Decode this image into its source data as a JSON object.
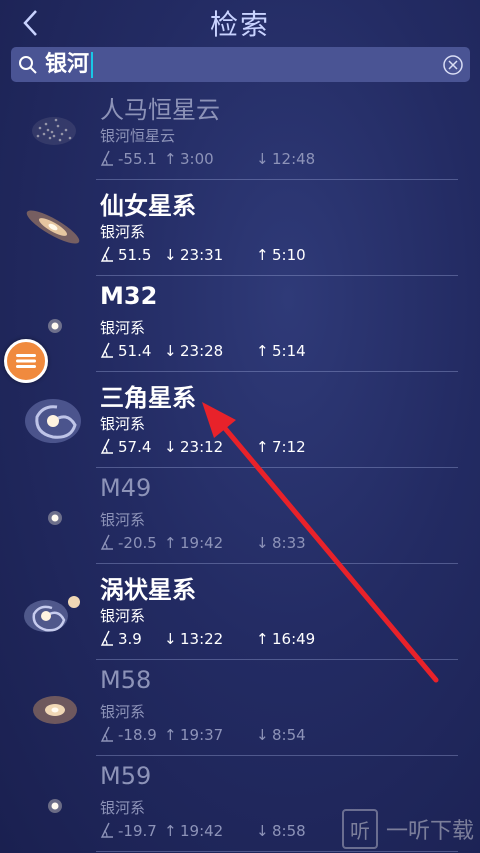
{
  "header": {
    "title": "检索",
    "back_icon": "chevron-left-icon"
  },
  "search": {
    "value": "银河",
    "search_icon": "magnifier-icon",
    "clear_icon": "clear-circle-icon"
  },
  "fab": {
    "icon": "menu-icon",
    "color": "#f08a3e"
  },
  "results": [
    {
      "name": "人马恒星云",
      "type": "银河恒星云",
      "alt": "-55.1",
      "rise_icon": "↑",
      "rise": "3:00",
      "set_icon": "↓",
      "set": "12:48",
      "dim": true,
      "thumb": "cloud"
    },
    {
      "name": "仙女星系",
      "type": "银河系",
      "alt": "51.5",
      "rise_icon": "↓",
      "rise": "23:31",
      "set_icon": "↑",
      "set": "5:10",
      "dim": false,
      "thumb": "andromeda"
    },
    {
      "name": "M32",
      "type": "银河系",
      "alt": "51.4",
      "rise_icon": "↓",
      "rise": "23:28",
      "set_icon": "↑",
      "set": "5:14",
      "dim": false,
      "thumb": "dot"
    },
    {
      "name": "三角星系",
      "type": "银河系",
      "alt": "57.4",
      "rise_icon": "↓",
      "rise": "23:12",
      "set_icon": "↑",
      "set": "7:12",
      "dim": false,
      "thumb": "spiral"
    },
    {
      "name": "M49",
      "type": "银河系",
      "alt": "-20.5",
      "rise_icon": "↑",
      "rise": "19:42",
      "set_icon": "↓",
      "set": "8:33",
      "dim": true,
      "thumb": "dot"
    },
    {
      "name": "涡状星系",
      "type": "银河系",
      "alt": "3.9",
      "rise_icon": "↓",
      "rise": "13:22",
      "set_icon": "↑",
      "set": "16:49",
      "dim": false,
      "thumb": "whirlpool"
    },
    {
      "name": "M58",
      "type": "银河系",
      "alt": "-18.9",
      "rise_icon": "↑",
      "rise": "19:37",
      "set_icon": "↓",
      "set": "8:54",
      "dim": true,
      "thumb": "oval"
    },
    {
      "name": "M59",
      "type": "银河系",
      "alt": "-19.7",
      "rise_icon": "↑",
      "rise": "19:42",
      "set_icon": "↓",
      "set": "8:58",
      "dim": true,
      "thumb": "dot"
    }
  ],
  "watermark": {
    "text": "一听下载",
    "logo": "听"
  }
}
